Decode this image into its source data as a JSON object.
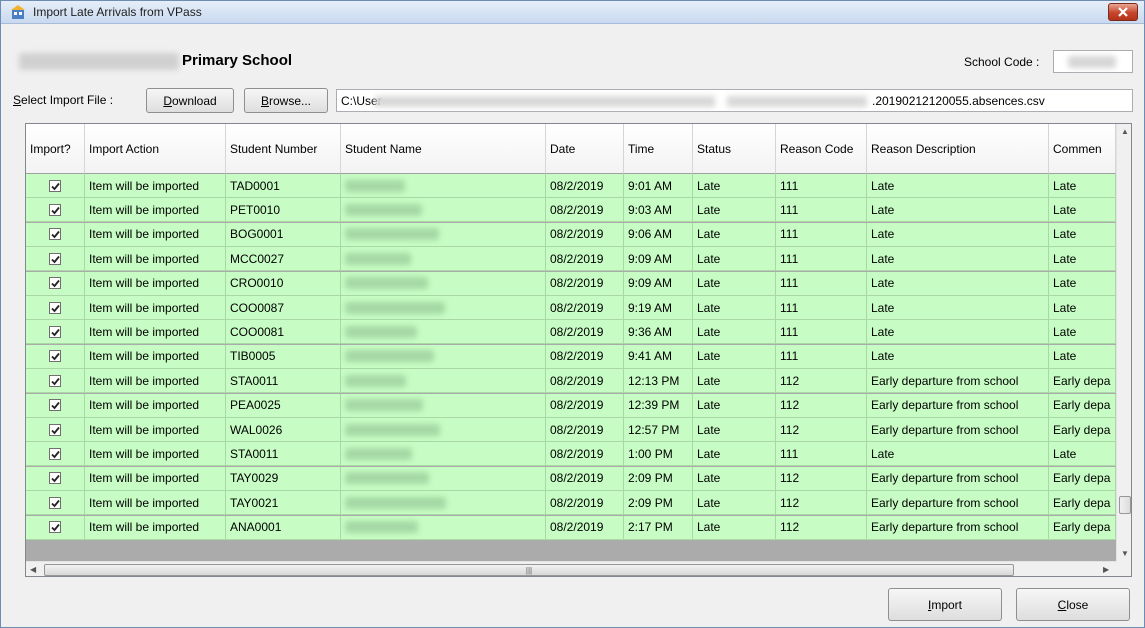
{
  "window": {
    "title": "Import Late Arrivals from VPass"
  },
  "school": {
    "name": "Primary School",
    "code_label": "School Code :"
  },
  "file": {
    "label": "Select Import File :",
    "download_label": "Download",
    "browse_label": "Browse...",
    "path_start": "C:\\User",
    "path_end": ".20190212120055.absences.csv"
  },
  "grid": {
    "columns": [
      "Import?",
      "Import Action",
      "Student Number",
      "Student Name",
      "Date",
      "Time",
      "Status",
      "Reason Code",
      "Reason Description",
      "Commen"
    ],
    "rows": [
      {
        "checked": true,
        "action": "Item will be imported",
        "number": "TAD0001",
        "date": "08/2/2019",
        "time": "9:01 AM",
        "status": "Late",
        "code": "111",
        "desc": "Late",
        "comment": "Late"
      },
      {
        "checked": true,
        "action": "Item will be imported",
        "number": "PET0010",
        "date": "08/2/2019",
        "time": "9:03 AM",
        "status": "Late",
        "code": "111",
        "desc": "Late",
        "comment": "Late"
      },
      {
        "checked": true,
        "action": "Item will be imported",
        "number": "BOG0001",
        "date": "08/2/2019",
        "time": "9:06 AM",
        "status": "Late",
        "code": "111",
        "desc": "Late",
        "comment": "Late"
      },
      {
        "checked": true,
        "action": "Item will be imported",
        "number": "MCC0027",
        "date": "08/2/2019",
        "time": "9:09 AM",
        "status": "Late",
        "code": "111",
        "desc": "Late",
        "comment": "Late"
      },
      {
        "checked": true,
        "action": "Item will be imported",
        "number": "CRO0010",
        "date": "08/2/2019",
        "time": "9:09 AM",
        "status": "Late",
        "code": "111",
        "desc": "Late",
        "comment": "Late"
      },
      {
        "checked": true,
        "action": "Item will be imported",
        "number": "COO0087",
        "date": "08/2/2019",
        "time": "9:19 AM",
        "status": "Late",
        "code": "111",
        "desc": "Late",
        "comment": "Late"
      },
      {
        "checked": true,
        "action": "Item will be imported",
        "number": "COO0081",
        "date": "08/2/2019",
        "time": "9:36 AM",
        "status": "Late",
        "code": "111",
        "desc": "Late",
        "comment": "Late"
      },
      {
        "checked": true,
        "action": "Item will be imported",
        "number": "TIB0005",
        "date": "08/2/2019",
        "time": "9:41 AM",
        "status": "Late",
        "code": "111",
        "desc": "Late",
        "comment": "Late"
      },
      {
        "checked": true,
        "action": "Item will be imported",
        "number": "STA0011",
        "date": "08/2/2019",
        "time": "12:13 PM",
        "status": "Late",
        "code": "112",
        "desc": "Early departure from school",
        "comment": "Early depa"
      },
      {
        "checked": true,
        "action": "Item will be imported",
        "number": "PEA0025",
        "date": "08/2/2019",
        "time": "12:39 PM",
        "status": "Late",
        "code": "112",
        "desc": "Early departure from school",
        "comment": "Early depa"
      },
      {
        "checked": true,
        "action": "Item will be imported",
        "number": "WAL0026",
        "date": "08/2/2019",
        "time": "12:57 PM",
        "status": "Late",
        "code": "112",
        "desc": "Early departure from school",
        "comment": "Early depa"
      },
      {
        "checked": true,
        "action": "Item will be imported",
        "number": "STA0011",
        "date": "08/2/2019",
        "time": "1:00 PM",
        "status": "Late",
        "code": "111",
        "desc": "Late",
        "comment": "Late"
      },
      {
        "checked": true,
        "action": "Item will be imported",
        "number": "TAY0029",
        "date": "08/2/2019",
        "time": "2:09 PM",
        "status": "Late",
        "code": "112",
        "desc": "Early departure from school",
        "comment": "Early depa"
      },
      {
        "checked": true,
        "action": "Item will be imported",
        "number": "TAY0021",
        "date": "08/2/2019",
        "time": "2:09 PM",
        "status": "Late",
        "code": "112",
        "desc": "Early departure from school",
        "comment": "Early depa"
      },
      {
        "checked": true,
        "action": "Item will be imported",
        "number": "ANA0001",
        "date": "08/2/2019",
        "time": "2:17 PM",
        "status": "Late",
        "code": "112",
        "desc": "Early departure from school",
        "comment": "Early depa"
      }
    ]
  },
  "buttons": {
    "import_label": "Import",
    "close_label": "Close"
  },
  "colors": {
    "row_bg": "#c7fdc4",
    "title_bar": "#dbe6f4",
    "close_red": "#c6452b"
  }
}
